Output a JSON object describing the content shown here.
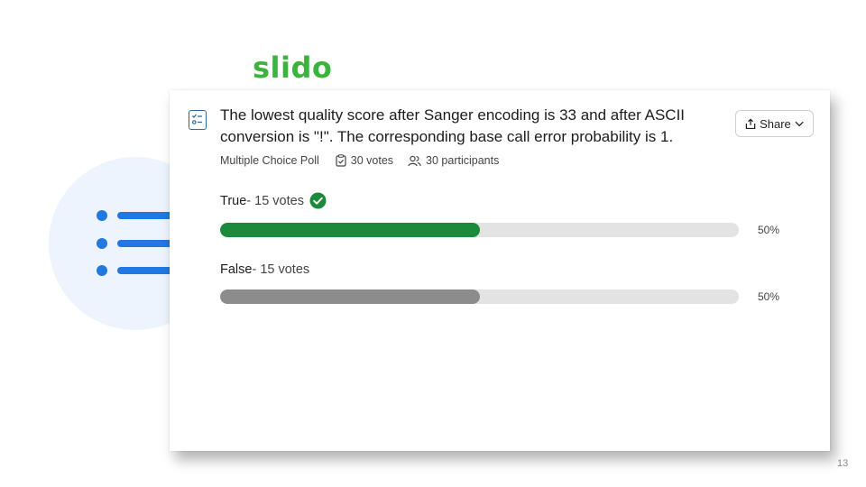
{
  "logo": {
    "text": "slido",
    "color": "#3bb33c"
  },
  "decoration": {
    "circle_color": "#eef4fd",
    "accent_color": "#2178e0",
    "icon": "list-icon"
  },
  "poll": {
    "question": "The lowest quality score after Sanger encoding is 33 and after ASCII conversion is \"!\". The corresponding base call error probability is 1.",
    "type": "Multiple Choice Poll",
    "votes": "30 votes",
    "participants": "30 participants",
    "icon": "poll-icon",
    "options": [
      {
        "name": "True",
        "votes": " - 15 votes",
        "percent": "50%",
        "fraction": 0.5,
        "correct": true,
        "color": "#1b8a3a"
      },
      {
        "name": "False",
        "votes": " - 15 votes",
        "percent": "50%",
        "fraction": 0.5,
        "correct": false,
        "color": "#8c8c8c"
      }
    ]
  },
  "share": {
    "label": "Share",
    "icon": "share-icon",
    "chevron": "chevron-down-icon"
  },
  "page_number": "13"
}
